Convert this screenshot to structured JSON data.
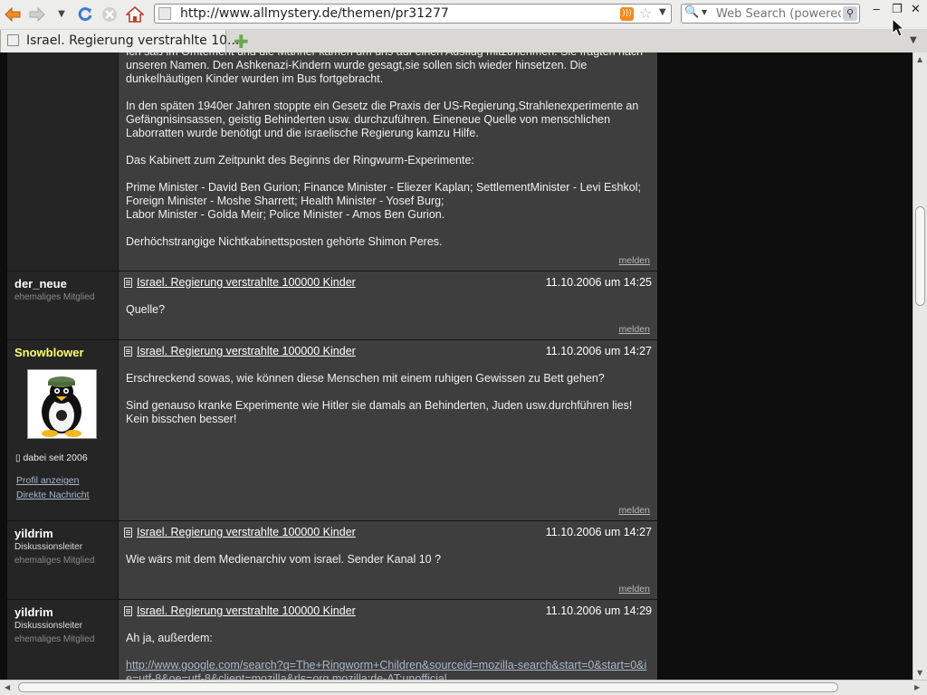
{
  "browser": {
    "url": "http://www.allmystery.de/themen/pr31277",
    "search_placeholder": "Web Search (powered",
    "tab_title": "Israel. Regierung verstrahlte 10...",
    "nav_icons": [
      "back-arrow-icon",
      "forward-arrow-icon",
      "history-dropdown-icon",
      "reload-icon",
      "stop-icon",
      "home-icon"
    ],
    "colors": {
      "back": "#e8751a",
      "reload": "#3a7bd5",
      "rss": "#f38b1d"
    }
  },
  "page": {
    "thread_title": "Israel. Regierung verstrahlte 100000 Kinder",
    "report_label": "melden",
    "first_post": {
      "paragraphs": [
        "Ich saß im Omtement und die Männer kamen um uns auf einen Ausflug mitzunehmen. Sie fragten nach unseren Namen. Den Ashkenazi-Kindern wurde gesagt,sie sollen sich wieder hinsetzen. Die dunkelhäutigen Kinder wurden im Bus fortgebracht.",
        "In den späten 1940er Jahren stoppte ein Gesetz die Praxis der US-Regierung,Strahlenexperimente an Gefängnisinsassen, geistig Behinderten usw. durchzuführen. Eineneue Quelle von menschlichen Laborratten wurde benötigt und die israelische Regierung kamzu Hilfe.",
        "Das Kabinett zum Zeitpunkt des Beginns der Ringwurm-Experimente:",
        "Prime Minister - David Ben Gurion; Finance Minister - Eliezer Kaplan; SettlementMinister - Levi Eshkol; Foreign Minister - Moshe Sharrett; Health Minister - Yosef Burg;\nLabor Minister - Golda Meir; Police Minister - Amos Ben Gurion.",
        "Derhöchstrangige Nichtkabinettsposten gehörte Shimon Peres."
      ]
    },
    "posts": [
      {
        "username": "der_neue",
        "status": "ehemaliges Mitglied",
        "date": "11.10.2006 um 14:25",
        "text": "Quelle?"
      },
      {
        "username": "Snowblower",
        "username_color": "#ffff66",
        "member_since": "dabei seit 2006",
        "profile_link": "Profil anzeigen",
        "message_link": "Direkte Nachricht",
        "avatar_icon": "tux-penguin-icon",
        "date": "11.10.2006 um 14:27",
        "paragraphs": [
          "Erschreckend sowas, wie können diese Menschen mit einem ruhigen Gewissen zu Bett gehen?",
          "Sind genauso kranke Experimente wie Hitler sie damals an Behinderten, Juden usw.durchführen lies! Kein bisschen besser!"
        ]
      },
      {
        "username": "yildrim",
        "rank": "Diskussionsleiter",
        "status": "ehemaliges Mitglied",
        "date": "11.10.2006 um 14:27",
        "text": "Wie wärs mit dem Medienarchiv vom israel. Sender Kanal 10 ?"
      },
      {
        "username": "yildrim",
        "rank": "Diskussionsleiter",
        "status": "ehemaliges Mitglied",
        "date": "11.10.2006 um 14:29",
        "text": "Ah ja, außerdem:",
        "link": "http://www.google.com/search?q=The+Ringworm+Children&sourceid=mozilla-search&start=0&start=0&ie=utf-8&oe=utf-8&client=mozilla&rls=org.mozilla:de-AT:unofficial"
      }
    ]
  }
}
